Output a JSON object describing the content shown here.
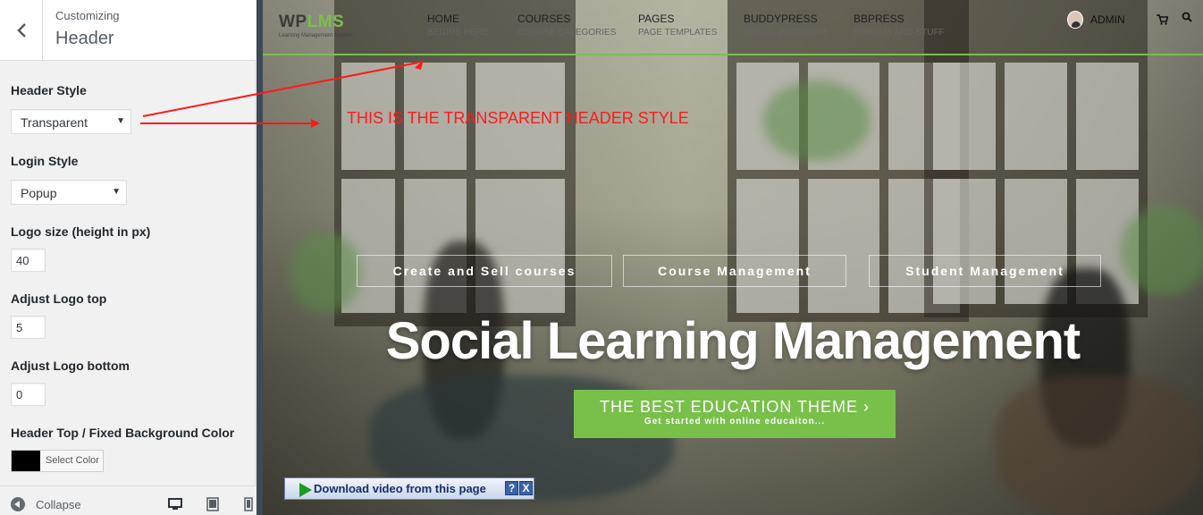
{
  "sidebar": {
    "subtitle": "Customizing",
    "title": "Header",
    "controls": {
      "header_style": {
        "label": "Header Style",
        "value": "Transparent"
      },
      "login_style": {
        "label": "Login Style",
        "value": "Popup"
      },
      "logo_size": {
        "label": "Logo size (height in px)",
        "value": "40"
      },
      "logo_top": {
        "label": "Adjust Logo top",
        "value": "5"
      },
      "logo_bottom": {
        "label": "Adjust Logo bottom",
        "value": "0"
      },
      "bg_color": {
        "label": "Header Top / Fixed Background Color",
        "button": "Select Color",
        "value": "#000000"
      }
    },
    "footer": {
      "collapse": "Collapse",
      "devices": [
        "desktop-icon",
        "tablet-icon",
        "mobile-icon"
      ]
    }
  },
  "preview": {
    "logo": {
      "main_a": "WP",
      "main_b": "LMS",
      "tagline": "Learning Management System"
    },
    "nav": [
      {
        "title": "HOME",
        "sub": "BEGINS HERE"
      },
      {
        "title": "COURSES",
        "sub": "COURSE CATEGORIES"
      },
      {
        "title": "PAGES",
        "sub": "PAGE TEMPLATES"
      },
      {
        "title": "BUDDYPRESS",
        "sub": "SOCIAL PLATFORM"
      },
      {
        "title": "BBPRESS",
        "sub": "FORUMS AND STUFF"
      }
    ],
    "admin": "ADMIN",
    "annotation": "THIS IS THE TRANSPARENT HEADER STYLE",
    "features": [
      "Create and Sell courses",
      "Course Management",
      "Student Management"
    ],
    "hero_title": "Social Learning Management",
    "cta": {
      "main": "THE BEST EDUCATION THEME ›",
      "sub": "Get started with online educaiton..."
    },
    "download_bar": {
      "label": "Download video from this page",
      "help": "?",
      "close": "X"
    }
  },
  "colors": {
    "accent": "#78c04a",
    "annotation": "#ff1a1a",
    "sidebar_bg": "#f1f1f1"
  }
}
